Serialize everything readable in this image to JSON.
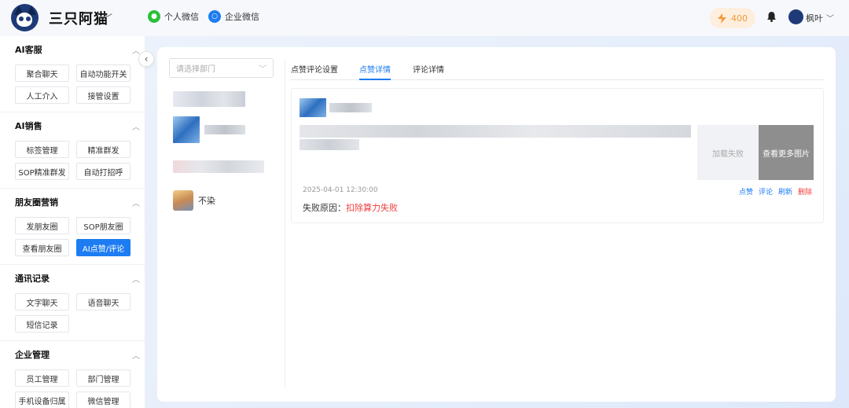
{
  "header": {
    "app_title": "三只阿猫",
    "personal_wechat": "个人微信",
    "enterprise_wechat": "企业微信",
    "points": "400",
    "user_name": "枫叶"
  },
  "sidebar": {
    "groups": [
      {
        "title": "AI客服",
        "items": [
          "聚合聊天",
          "自动功能开关",
          "人工介入",
          "接管设置"
        ]
      },
      {
        "title": "AI销售",
        "items": [
          "标签管理",
          "精准群发",
          "SOP精准群发",
          "自动打招呼"
        ]
      },
      {
        "title": "朋友圈营销",
        "items": [
          "发朋友圈",
          "SOP朋友圈",
          "查看朋友圈",
          "AI点赞/评论"
        ]
      },
      {
        "title": "通讯记录",
        "items": [
          "文字聊天",
          "语音聊天",
          "短信记录"
        ]
      },
      {
        "title": "企业管理",
        "items": [
          "员工管理",
          "部门管理",
          "手机设备归属",
          "微信管理"
        ]
      }
    ],
    "active_item": "AI点赞/评论"
  },
  "panel": {
    "dept_placeholder": "请选择部门",
    "account_visible_name": "不染",
    "tabs": [
      "点赞评论设置",
      "点赞详情",
      "评论详情"
    ],
    "active_tab": "点赞详情"
  },
  "card": {
    "img_fail": "加载失败",
    "img_more": "查看更多图片",
    "timestamp": "2025-04-01 12:30:00",
    "actions": [
      "点赞",
      "评论",
      "刷新",
      "删除"
    ],
    "fail_label": "失败原因：",
    "fail_reason": "扣除算力失败"
  },
  "colors": {
    "accent": "#1d7cf2",
    "danger": "#f23c3c",
    "wechat_green": "#2ac03a",
    "points_orange": "#f29a3a"
  }
}
